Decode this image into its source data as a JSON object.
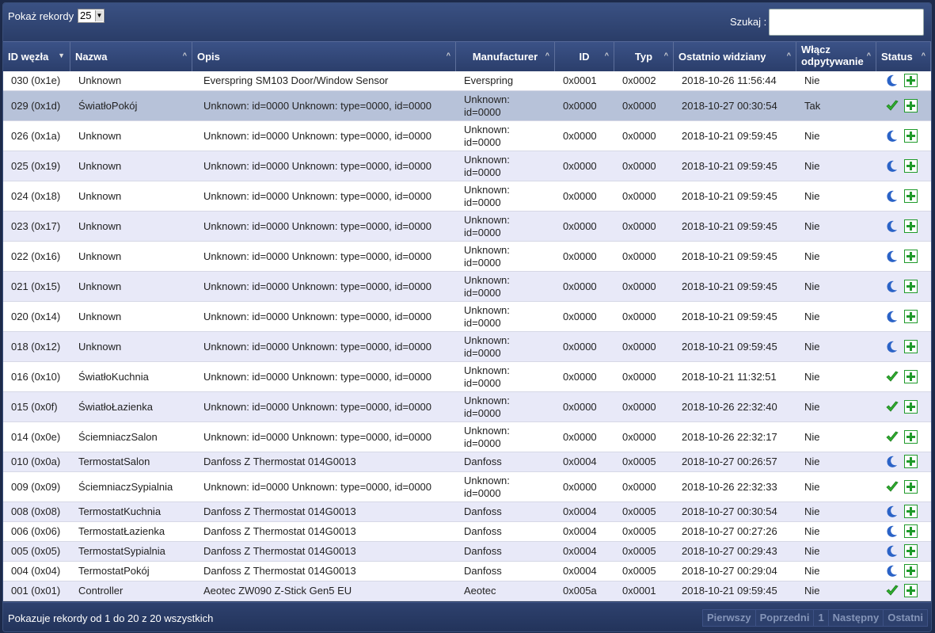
{
  "toolbar": {
    "show_label": "Pokaż rekordy",
    "page_size": "25",
    "search_label": "Szukaj :",
    "search_value": ""
  },
  "columns": [
    {
      "label": "ID węzła",
      "sort": "desc"
    },
    {
      "label": "Nazwa",
      "sort": "asc"
    },
    {
      "label": "Opis",
      "sort": "asc"
    },
    {
      "label": "Manufacturer",
      "sort": "asc"
    },
    {
      "label": "ID",
      "sort": "asc"
    },
    {
      "label": "Typ",
      "sort": "asc"
    },
    {
      "label": "Ostatnio widziany",
      "sort": "asc"
    },
    {
      "label": "Włącz odpytywanie",
      "sort": "asc"
    },
    {
      "label": "Status",
      "sort": "asc"
    }
  ],
  "rows": [
    {
      "node": "030 (0x1e)",
      "name": "Unknown",
      "desc": "Everspring SM103 Door/Window Sensor",
      "mfr": "Everspring",
      "id": "0x0001",
      "type": "0x0002",
      "seen": "2018-10-26 11:56:44",
      "poll": "Nie",
      "status": "sleep"
    },
    {
      "node": "029 (0x1d)",
      "name": "ŚwiatłoPokój",
      "desc": "Unknown: id=0000 Unknown: type=0000, id=0000",
      "mfr": "Unknown: id=0000",
      "id": "0x0000",
      "type": "0x0000",
      "seen": "2018-10-27 00:30:54",
      "poll": "Tak",
      "status": "ok",
      "selected": true
    },
    {
      "node": "026 (0x1a)",
      "name": "Unknown",
      "desc": "Unknown: id=0000 Unknown: type=0000, id=0000",
      "mfr": "Unknown: id=0000",
      "id": "0x0000",
      "type": "0x0000",
      "seen": "2018-10-21 09:59:45",
      "poll": "Nie",
      "status": "sleep"
    },
    {
      "node": "025 (0x19)",
      "name": "Unknown",
      "desc": "Unknown: id=0000 Unknown: type=0000, id=0000",
      "mfr": "Unknown: id=0000",
      "id": "0x0000",
      "type": "0x0000",
      "seen": "2018-10-21 09:59:45",
      "poll": "Nie",
      "status": "sleep"
    },
    {
      "node": "024 (0x18)",
      "name": "Unknown",
      "desc": "Unknown: id=0000 Unknown: type=0000, id=0000",
      "mfr": "Unknown: id=0000",
      "id": "0x0000",
      "type": "0x0000",
      "seen": "2018-10-21 09:59:45",
      "poll": "Nie",
      "status": "sleep"
    },
    {
      "node": "023 (0x17)",
      "name": "Unknown",
      "desc": "Unknown: id=0000 Unknown: type=0000, id=0000",
      "mfr": "Unknown: id=0000",
      "id": "0x0000",
      "type": "0x0000",
      "seen": "2018-10-21 09:59:45",
      "poll": "Nie",
      "status": "sleep"
    },
    {
      "node": "022 (0x16)",
      "name": "Unknown",
      "desc": "Unknown: id=0000 Unknown: type=0000, id=0000",
      "mfr": "Unknown: id=0000",
      "id": "0x0000",
      "type": "0x0000",
      "seen": "2018-10-21 09:59:45",
      "poll": "Nie",
      "status": "sleep"
    },
    {
      "node": "021 (0x15)",
      "name": "Unknown",
      "desc": "Unknown: id=0000 Unknown: type=0000, id=0000",
      "mfr": "Unknown: id=0000",
      "id": "0x0000",
      "type": "0x0000",
      "seen": "2018-10-21 09:59:45",
      "poll": "Nie",
      "status": "sleep"
    },
    {
      "node": "020 (0x14)",
      "name": "Unknown",
      "desc": "Unknown: id=0000 Unknown: type=0000, id=0000",
      "mfr": "Unknown: id=0000",
      "id": "0x0000",
      "type": "0x0000",
      "seen": "2018-10-21 09:59:45",
      "poll": "Nie",
      "status": "sleep"
    },
    {
      "node": "018 (0x12)",
      "name": "Unknown",
      "desc": "Unknown: id=0000 Unknown: type=0000, id=0000",
      "mfr": "Unknown: id=0000",
      "id": "0x0000",
      "type": "0x0000",
      "seen": "2018-10-21 09:59:45",
      "poll": "Nie",
      "status": "sleep"
    },
    {
      "node": "016 (0x10)",
      "name": "ŚwiatłoKuchnia",
      "desc": "Unknown: id=0000 Unknown: type=0000, id=0000",
      "mfr": "Unknown: id=0000",
      "id": "0x0000",
      "type": "0x0000",
      "seen": "2018-10-21 11:32:51",
      "poll": "Nie",
      "status": "ok"
    },
    {
      "node": "015 (0x0f)",
      "name": "ŚwiatłoŁazienka",
      "desc": "Unknown: id=0000 Unknown: type=0000, id=0000",
      "mfr": "Unknown: id=0000",
      "id": "0x0000",
      "type": "0x0000",
      "seen": "2018-10-26 22:32:40",
      "poll": "Nie",
      "status": "ok"
    },
    {
      "node": "014 (0x0e)",
      "name": "ŚciemniaczSalon",
      "desc": "Unknown: id=0000 Unknown: type=0000, id=0000",
      "mfr": "Unknown: id=0000",
      "id": "0x0000",
      "type": "0x0000",
      "seen": "2018-10-26 22:32:17",
      "poll": "Nie",
      "status": "ok"
    },
    {
      "node": "010 (0x0a)",
      "name": "TermostatSalon",
      "desc": "Danfoss Z Thermostat 014G0013",
      "mfr": "Danfoss",
      "id": "0x0004",
      "type": "0x0005",
      "seen": "2018-10-27 00:26:57",
      "poll": "Nie",
      "status": "sleep"
    },
    {
      "node": "009 (0x09)",
      "name": "ŚciemniaczSypialnia",
      "desc": "Unknown: id=0000 Unknown: type=0000, id=0000",
      "mfr": "Unknown: id=0000",
      "id": "0x0000",
      "type": "0x0000",
      "seen": "2018-10-26 22:32:33",
      "poll": "Nie",
      "status": "ok"
    },
    {
      "node": "008 (0x08)",
      "name": "TermostatKuchnia",
      "desc": "Danfoss Z Thermostat 014G0013",
      "mfr": "Danfoss",
      "id": "0x0004",
      "type": "0x0005",
      "seen": "2018-10-27 00:30:54",
      "poll": "Nie",
      "status": "sleep"
    },
    {
      "node": "006 (0x06)",
      "name": "TermostatŁazienka",
      "desc": "Danfoss Z Thermostat 014G0013",
      "mfr": "Danfoss",
      "id": "0x0004",
      "type": "0x0005",
      "seen": "2018-10-27 00:27:26",
      "poll": "Nie",
      "status": "sleep"
    },
    {
      "node": "005 (0x05)",
      "name": "TermostatSypialnia",
      "desc": "Danfoss Z Thermostat 014G0013",
      "mfr": "Danfoss",
      "id": "0x0004",
      "type": "0x0005",
      "seen": "2018-10-27 00:29:43",
      "poll": "Nie",
      "status": "sleep"
    },
    {
      "node": "004 (0x04)",
      "name": "TermostatPokój",
      "desc": "Danfoss Z Thermostat 014G0013",
      "mfr": "Danfoss",
      "id": "0x0004",
      "type": "0x0005",
      "seen": "2018-10-27 00:29:04",
      "poll": "Nie",
      "status": "sleep"
    },
    {
      "node": "001 (0x01)",
      "name": "Controller",
      "desc": "Aeotec ZW090 Z-Stick Gen5 EU",
      "mfr": "Aeotec",
      "id": "0x005a",
      "type": "0x0001",
      "seen": "2018-10-21 09:59:45",
      "poll": "Nie",
      "status": "ok"
    }
  ],
  "footer": {
    "info": "Pokazuje rekordy od 1 do 20 z 20 wszystkich",
    "first": "Pierwszy",
    "prev": "Poprzedni",
    "page": "1",
    "next": "Następny",
    "last": "Ostatni"
  },
  "colors": {
    "row_odd": "#ffffff",
    "row_even": "#e8e9f8",
    "row_selected": "#b7c2d9",
    "ok_icon": "#2fae2f",
    "sleep_icon": "#2b63c7",
    "add_icon": "#1f9a2a"
  }
}
